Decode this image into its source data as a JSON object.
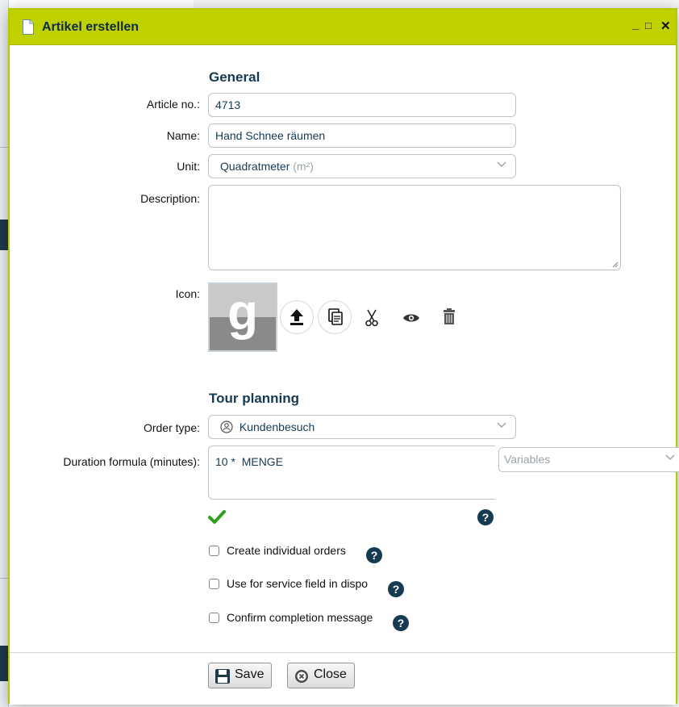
{
  "window": {
    "title": "Artikel erstellen",
    "minimize": "_",
    "maximize": "□",
    "close": "✕"
  },
  "general": {
    "heading": "General",
    "article_no": {
      "label": "Article no.:",
      "value": "4713"
    },
    "name": {
      "label": "Name:",
      "value": "Hand Schnee räumen"
    },
    "unit": {
      "label": "Unit:",
      "value": "Quadratmeter",
      "suffix": "(m²)"
    },
    "description": {
      "label": "Description:",
      "value": ""
    },
    "icon": {
      "label": "Icon:",
      "letter": "g"
    }
  },
  "tour": {
    "heading": "Tour planning",
    "order_type": {
      "label": "Order type:",
      "value": "Kundenbesuch"
    },
    "duration": {
      "label": "Duration formula (minutes):",
      "value": "10 *  MENGE"
    },
    "variables_placeholder": "Variables",
    "options": [
      {
        "label": "Create individual orders",
        "checked": false
      },
      {
        "label": "Use for service field in dispo",
        "checked": false
      },
      {
        "label": "Confirm completion message",
        "checked": false
      }
    ]
  },
  "footer": {
    "save_label": "Save",
    "close_label": "Close"
  },
  "help_glyph": "?",
  "colors": {
    "titlebar": "#bfd100",
    "heading": "#163a52",
    "valid": "#2e9e1f"
  }
}
